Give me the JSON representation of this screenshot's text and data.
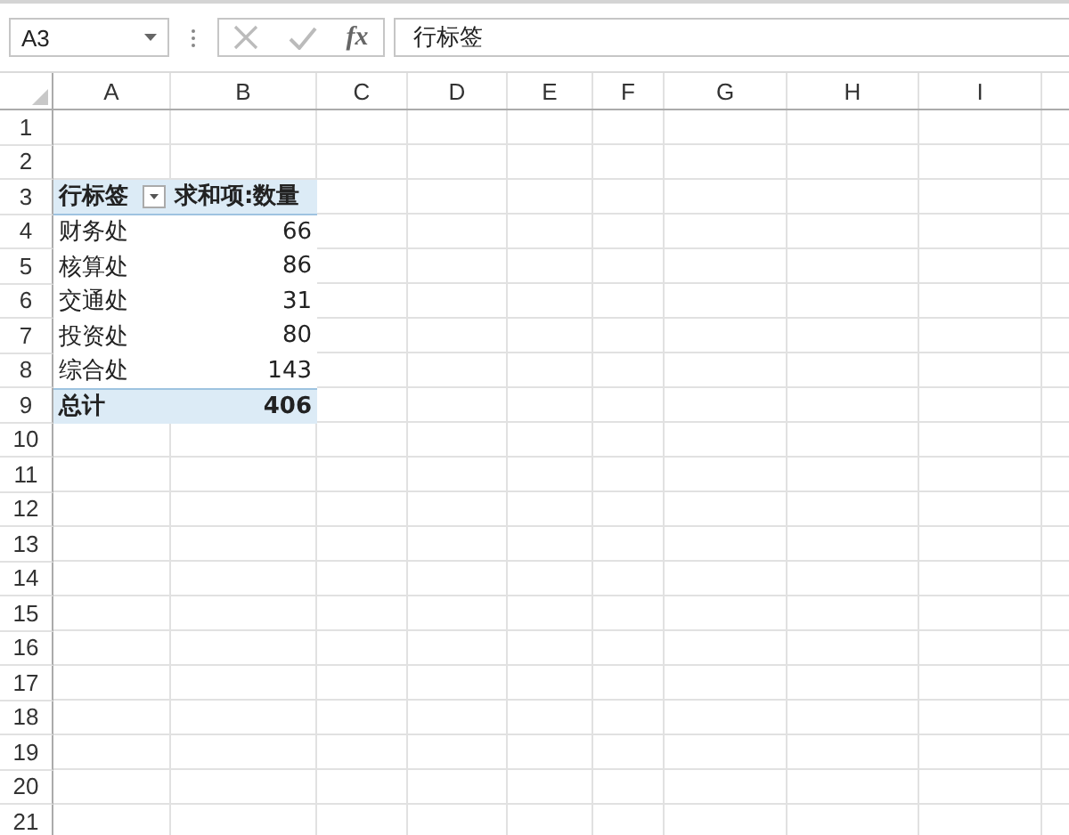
{
  "name_box": {
    "value": "A3"
  },
  "formula_bar": {
    "function_label": "fx",
    "value": "行标签"
  },
  "columns": [
    "A",
    "B",
    "C",
    "D",
    "E",
    "F",
    "G",
    "H",
    "I"
  ],
  "rows": [
    {
      "number": "1",
      "kind": "empty"
    },
    {
      "number": "2",
      "kind": "empty"
    },
    {
      "number": "3",
      "kind": "pivot-header",
      "cells": [
        "行标签",
        "求和项:数量"
      ]
    },
    {
      "number": "4",
      "kind": "pivot-row",
      "cells": [
        "财务处",
        "66"
      ]
    },
    {
      "number": "5",
      "kind": "pivot-row",
      "cells": [
        "核算处",
        "86"
      ]
    },
    {
      "number": "6",
      "kind": "pivot-row",
      "cells": [
        "交通处",
        "31"
      ]
    },
    {
      "number": "7",
      "kind": "pivot-row",
      "cells": [
        "投资处",
        "80"
      ]
    },
    {
      "number": "8",
      "kind": "pivot-row",
      "cells": [
        "综合处",
        "143"
      ]
    },
    {
      "number": "9",
      "kind": "pivot-total",
      "cells": [
        "总计",
        "406"
      ]
    },
    {
      "number": "10",
      "kind": "empty"
    },
    {
      "number": "11",
      "kind": "empty"
    },
    {
      "number": "12",
      "kind": "empty"
    },
    {
      "number": "13",
      "kind": "empty"
    },
    {
      "number": "14",
      "kind": "empty"
    },
    {
      "number": "15",
      "kind": "empty"
    },
    {
      "number": "16",
      "kind": "empty"
    },
    {
      "number": "17",
      "kind": "empty"
    },
    {
      "number": "18",
      "kind": "empty"
    },
    {
      "number": "19",
      "kind": "empty"
    },
    {
      "number": "20",
      "kind": "empty"
    },
    {
      "number": "21",
      "kind": "empty"
    }
  ]
}
